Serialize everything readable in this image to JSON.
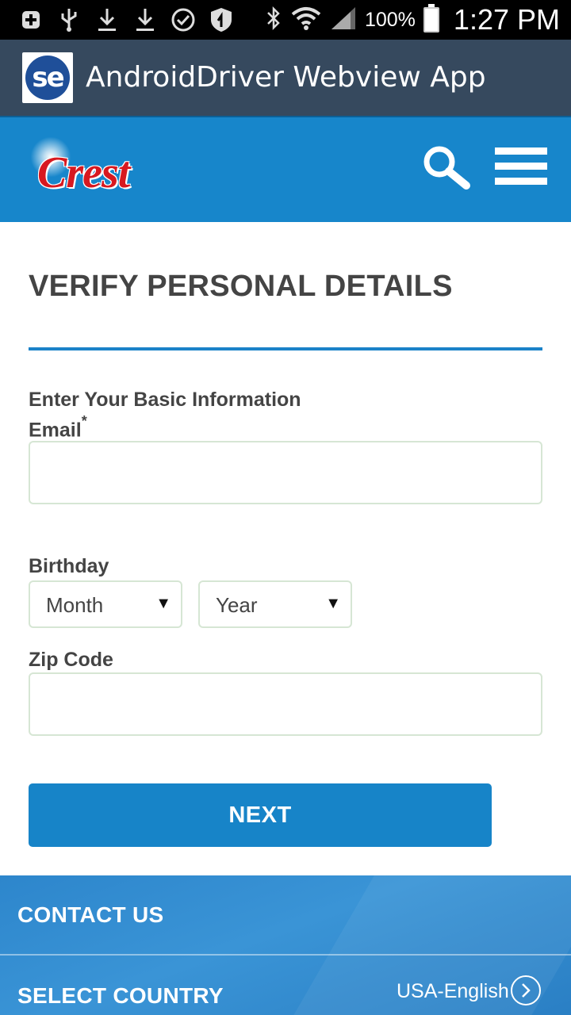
{
  "status_bar": {
    "icons": [
      "add-icon",
      "usb-icon",
      "download-icon",
      "download-icon",
      "check-circle-icon",
      "shield-icon",
      "bluetooth-icon",
      "wifi-icon",
      "signal-icon",
      "battery-icon"
    ],
    "battery_percent": "100%",
    "time": "1:27 PM"
  },
  "app_bar": {
    "logo_text": "se",
    "title": "AndroidDriver Webview App"
  },
  "site_header": {
    "brand": "Crest",
    "brand_color": "#d71920",
    "header_color": "#1786cb"
  },
  "form": {
    "title": "VERIFY PERSONAL DETAILS",
    "section_label": "Enter Your Basic Information",
    "email_label": "Email",
    "required_mark": "*",
    "email_value": "",
    "birthday_label": "Birthday",
    "month_selected": "Month",
    "year_selected": "Year",
    "zip_label": "Zip Code",
    "zip_value": "",
    "next_label": "NEXT"
  },
  "footer": {
    "contact_us": "CONTACT US",
    "select_country": "SELECT COUNTRY",
    "country_value": "USA-English"
  },
  "colors": {
    "accent": "#1784c8",
    "app_bar": "#36495e",
    "text": "#444444"
  }
}
